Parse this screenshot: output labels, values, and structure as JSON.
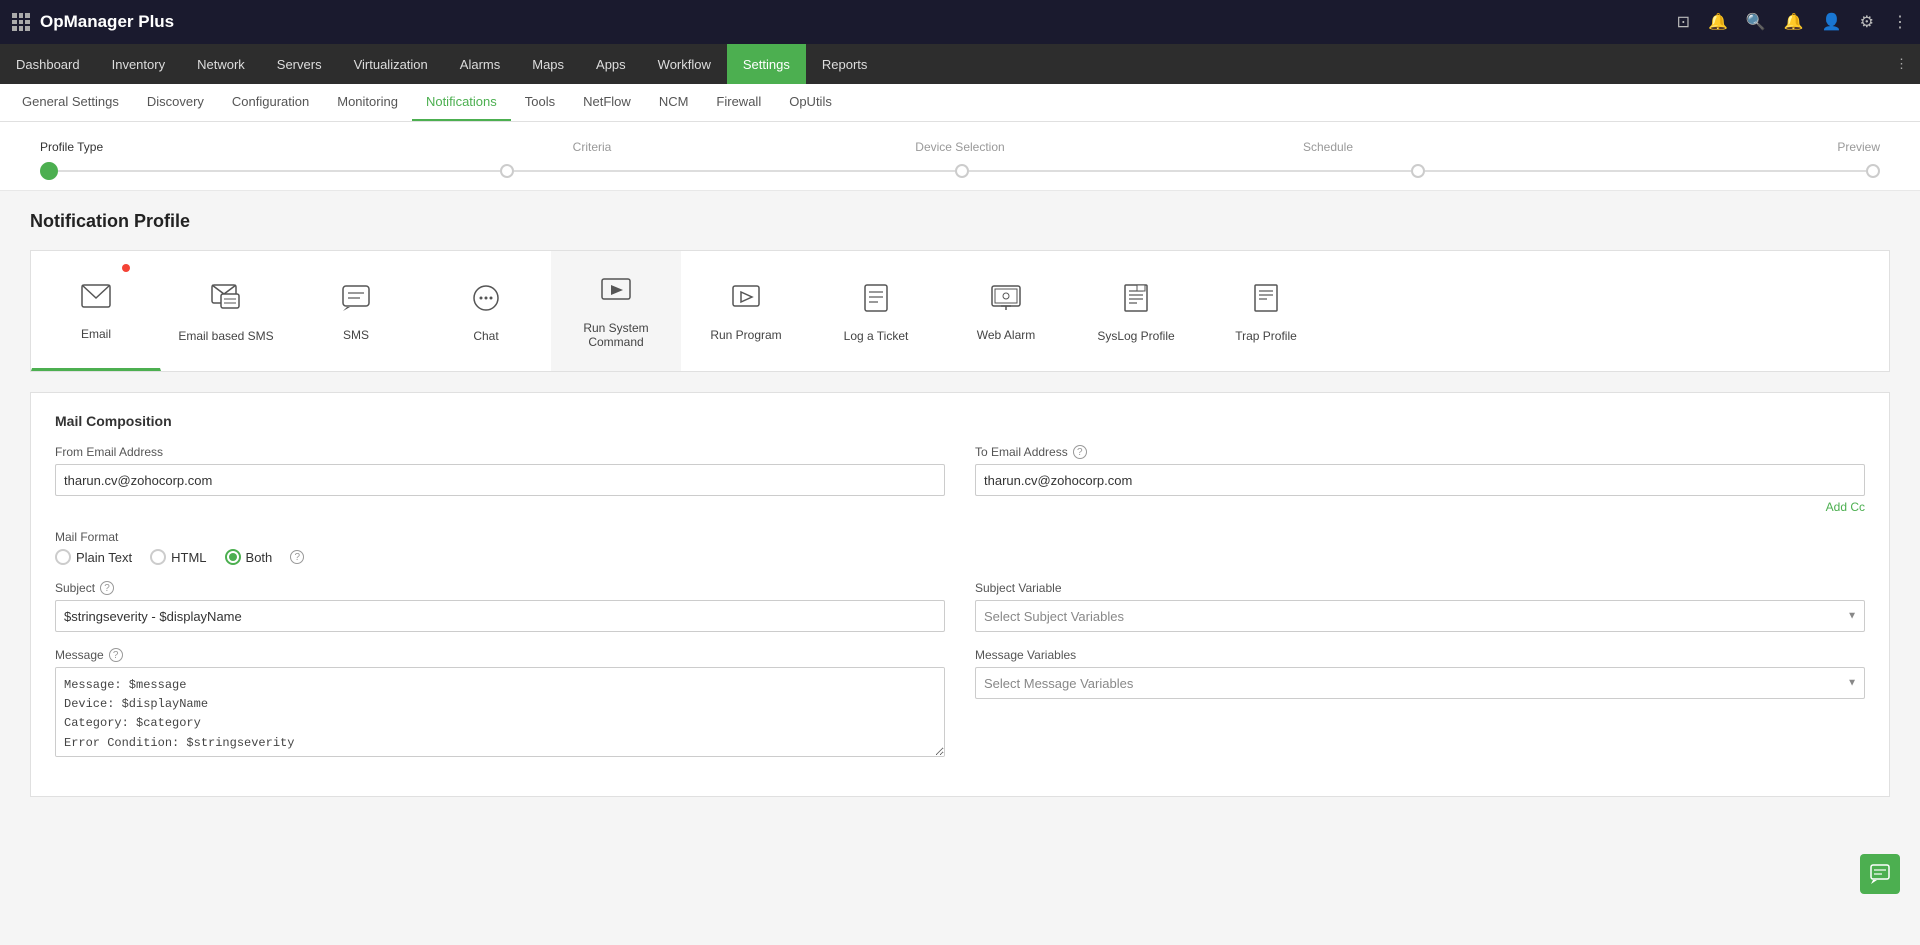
{
  "app": {
    "logo": "OpManager Plus",
    "grid_icon": "grid-icon"
  },
  "topbar": {
    "icons": [
      "screen-icon",
      "bell-outline-icon",
      "search-icon",
      "bell-icon",
      "user-icon",
      "settings-icon",
      "more-icon"
    ]
  },
  "nav": {
    "items": [
      {
        "label": "Dashboard",
        "active": false
      },
      {
        "label": "Inventory",
        "active": false
      },
      {
        "label": "Network",
        "active": false
      },
      {
        "label": "Servers",
        "active": false
      },
      {
        "label": "Virtualization",
        "active": false
      },
      {
        "label": "Alarms",
        "active": false
      },
      {
        "label": "Maps",
        "active": false
      },
      {
        "label": "Apps",
        "active": false
      },
      {
        "label": "Workflow",
        "active": false
      },
      {
        "label": "Settings",
        "active": true
      },
      {
        "label": "Reports",
        "active": false
      }
    ]
  },
  "subnav": {
    "items": [
      {
        "label": "General Settings",
        "active": false
      },
      {
        "label": "Discovery",
        "active": false
      },
      {
        "label": "Configuration",
        "active": false
      },
      {
        "label": "Monitoring",
        "active": false
      },
      {
        "label": "Notifications",
        "active": true
      },
      {
        "label": "Tools",
        "active": false
      },
      {
        "label": "NetFlow",
        "active": false
      },
      {
        "label": "NCM",
        "active": false
      },
      {
        "label": "Firewall",
        "active": false
      },
      {
        "label": "OpUtils",
        "active": false
      }
    ]
  },
  "wizard": {
    "steps": [
      {
        "label": "Profile Type",
        "active": true
      },
      {
        "label": "Criteria",
        "active": false
      },
      {
        "label": "Device Selection",
        "active": false
      },
      {
        "label": "Schedule",
        "active": false
      },
      {
        "label": "Preview",
        "active": false
      }
    ]
  },
  "page_title": "Notification Profile",
  "profile_types": [
    {
      "id": "email",
      "label": "Email",
      "icon": "✉",
      "active": true,
      "badge": true
    },
    {
      "id": "email-sms",
      "label": "Email based SMS",
      "icon": "📧",
      "active": false,
      "badge": false
    },
    {
      "id": "sms",
      "label": "SMS",
      "icon": "💬",
      "active": false,
      "badge": false
    },
    {
      "id": "chat",
      "label": "Chat",
      "icon": "🗨",
      "active": false,
      "badge": false
    },
    {
      "id": "run-system",
      "label": "Run System Command",
      "icon": "▶",
      "active": false,
      "badge": false,
      "dimmed": true
    },
    {
      "id": "run-program",
      "label": "Run Program",
      "icon": "▷",
      "active": false,
      "badge": false
    },
    {
      "id": "log-ticket",
      "label": "Log a Ticket",
      "icon": "📄",
      "active": false,
      "badge": false
    },
    {
      "id": "web-alarm",
      "label": "Web Alarm",
      "icon": "🖥",
      "active": false,
      "badge": false
    },
    {
      "id": "syslog",
      "label": "SysLog Profile",
      "icon": "📋",
      "active": false,
      "badge": false
    },
    {
      "id": "trap",
      "label": "Trap Profile",
      "icon": "📃",
      "active": false,
      "badge": false
    }
  ],
  "mail_composition": {
    "title": "Mail Composition",
    "from_email_label": "From Email Address",
    "from_email_value": "tharun.cv@zohocorp.com",
    "to_email_label": "To Email Address",
    "to_email_value": "tharun.cv@zohocorp.com",
    "add_cc_label": "Add Cc",
    "mail_format_label": "Mail Format",
    "mail_formats": [
      {
        "label": "Plain Text",
        "active": false
      },
      {
        "label": "HTML",
        "active": false
      },
      {
        "label": "Both",
        "active": true
      }
    ],
    "subject_label": "Subject",
    "subject_value": "$stringseverity - $displayName",
    "subject_variable_label": "Subject Variable",
    "subject_variable_placeholder": "Select Subject Variables",
    "message_label": "Message",
    "message_value": "Message: $message\nDevice: $displayName\nCategory: $category\nError Condition: $stringseverity\nGenerated at: $strModTime",
    "message_variable_label": "Message Variables",
    "message_variable_placeholder": "Select Message Variables"
  },
  "colors": {
    "active_green": "#4caf50",
    "nav_bg": "#2d2d2d",
    "topbar_bg": "#1a1a2e"
  }
}
